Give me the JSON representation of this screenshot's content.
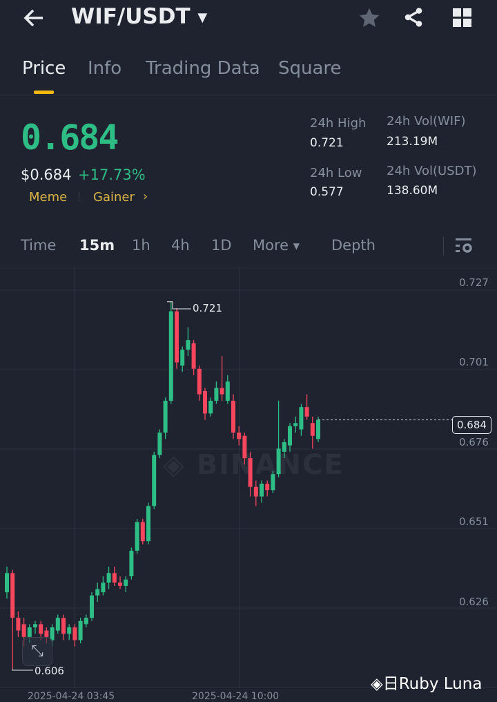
{
  "header": {
    "title": "WIF/USDT"
  },
  "tabs": [
    "Price",
    "Info",
    "Trading Data",
    "Square"
  ],
  "price": {
    "last": "0.684",
    "usd": "$0.684",
    "change": "+17.73%",
    "tags": [
      "Meme",
      "Gainer"
    ]
  },
  "stats": {
    "high_label": "24h High",
    "high": "0.721",
    "low_label": "24h Low",
    "low": "0.577",
    "vol_base_label": "24h Vol(WIF)",
    "vol_base": "213.19M",
    "vol_quote_label": "24h Vol(USDT)",
    "vol_quote": "138.60M"
  },
  "timeframes": {
    "time": "Time",
    "m15": "15m",
    "h1": "1h",
    "h4": "4h",
    "d1": "1D",
    "more": "More",
    "depth": "Depth"
  },
  "chart": {
    "yticks": [
      "0.727",
      "0.701",
      "0.676",
      "0.651",
      "0.626"
    ],
    "current": "0.684",
    "high_marker": "0.721",
    "low_marker": "0.606",
    "xticks": [
      "2025-04-24 03:45",
      "2025-04-24 10:00"
    ],
    "watermark": "BINANCE",
    "footer": "Ruby Luna",
    "up": "#2ebd85",
    "down": "#f6465d"
  },
  "chart_data": {
    "type": "candlestick",
    "interval": "15m",
    "ylim": [
      0.6,
      0.73
    ],
    "candles": [
      [
        0.63,
        0.638,
        0.628,
        0.636
      ],
      [
        0.636,
        0.637,
        0.606,
        0.622
      ],
      [
        0.622,
        0.624,
        0.616,
        0.618
      ],
      [
        0.62,
        0.622,
        0.613,
        0.616
      ],
      [
        0.616,
        0.62,
        0.614,
        0.619
      ],
      [
        0.619,
        0.621,
        0.617,
        0.62
      ],
      [
        0.62,
        0.621,
        0.615,
        0.617
      ],
      [
        0.618,
        0.619,
        0.614,
        0.616
      ],
      [
        0.615,
        0.62,
        0.613,
        0.619
      ],
      [
        0.618,
        0.623,
        0.617,
        0.622
      ],
      [
        0.622,
        0.623,
        0.615,
        0.617
      ],
      [
        0.617,
        0.62,
        0.615,
        0.619
      ],
      [
        0.619,
        0.62,
        0.613,
        0.615
      ],
      [
        0.615,
        0.622,
        0.614,
        0.621
      ],
      [
        0.62,
        0.623,
        0.619,
        0.622
      ],
      [
        0.622,
        0.63,
        0.621,
        0.629
      ],
      [
        0.629,
        0.633,
        0.627,
        0.631
      ],
      [
        0.63,
        0.635,
        0.629,
        0.633
      ],
      [
        0.633,
        0.638,
        0.631,
        0.636
      ],
      [
        0.636,
        0.638,
        0.632,
        0.633
      ],
      [
        0.633,
        0.635,
        0.631,
        0.632
      ],
      [
        0.632,
        0.635,
        0.63,
        0.634
      ],
      [
        0.635,
        0.644,
        0.634,
        0.643
      ],
      [
        0.643,
        0.653,
        0.642,
        0.652
      ],
      [
        0.652,
        0.653,
        0.645,
        0.646
      ],
      [
        0.646,
        0.658,
        0.645,
        0.657
      ],
      [
        0.657,
        0.674,
        0.656,
        0.673
      ],
      [
        0.673,
        0.681,
        0.672,
        0.68
      ],
      [
        0.68,
        0.691,
        0.678,
        0.69
      ],
      [
        0.69,
        0.721,
        0.689,
        0.718
      ],
      [
        0.718,
        0.719,
        0.7,
        0.702
      ],
      [
        0.701,
        0.707,
        0.699,
        0.706
      ],
      [
        0.706,
        0.713,
        0.704,
        0.709
      ],
      [
        0.708,
        0.709,
        0.698,
        0.7
      ],
      [
        0.7,
        0.701,
        0.69,
        0.692
      ],
      [
        0.693,
        0.694,
        0.684,
        0.686
      ],
      [
        0.686,
        0.691,
        0.685,
        0.69
      ],
      [
        0.69,
        0.696,
        0.689,
        0.694
      ],
      [
        0.694,
        0.704,
        0.69,
        0.692
      ],
      [
        0.69,
        0.698,
        0.689,
        0.696
      ],
      [
        0.69,
        0.692,
        0.678,
        0.68
      ],
      [
        0.68,
        0.682,
        0.676,
        0.678
      ],
      [
        0.679,
        0.68,
        0.67,
        0.672
      ],
      [
        0.672,
        0.674,
        0.66,
        0.663
      ],
      [
        0.663,
        0.665,
        0.657,
        0.66
      ],
      [
        0.66,
        0.665,
        0.658,
        0.664
      ],
      [
        0.664,
        0.665,
        0.66,
        0.662
      ],
      [
        0.662,
        0.668,
        0.661,
        0.667
      ],
      [
        0.667,
        0.69,
        0.666,
        0.675
      ],
      [
        0.674,
        0.678,
        0.672,
        0.677
      ],
      [
        0.676,
        0.683,
        0.674,
        0.682
      ],
      [
        0.682,
        0.685,
        0.68,
        0.683
      ],
      [
        0.681,
        0.689,
        0.679,
        0.688
      ],
      [
        0.688,
        0.692,
        0.684,
        0.685
      ],
      [
        0.683,
        0.685,
        0.675,
        0.679
      ],
      [
        0.678,
        0.685,
        0.677,
        0.684
      ]
    ]
  }
}
